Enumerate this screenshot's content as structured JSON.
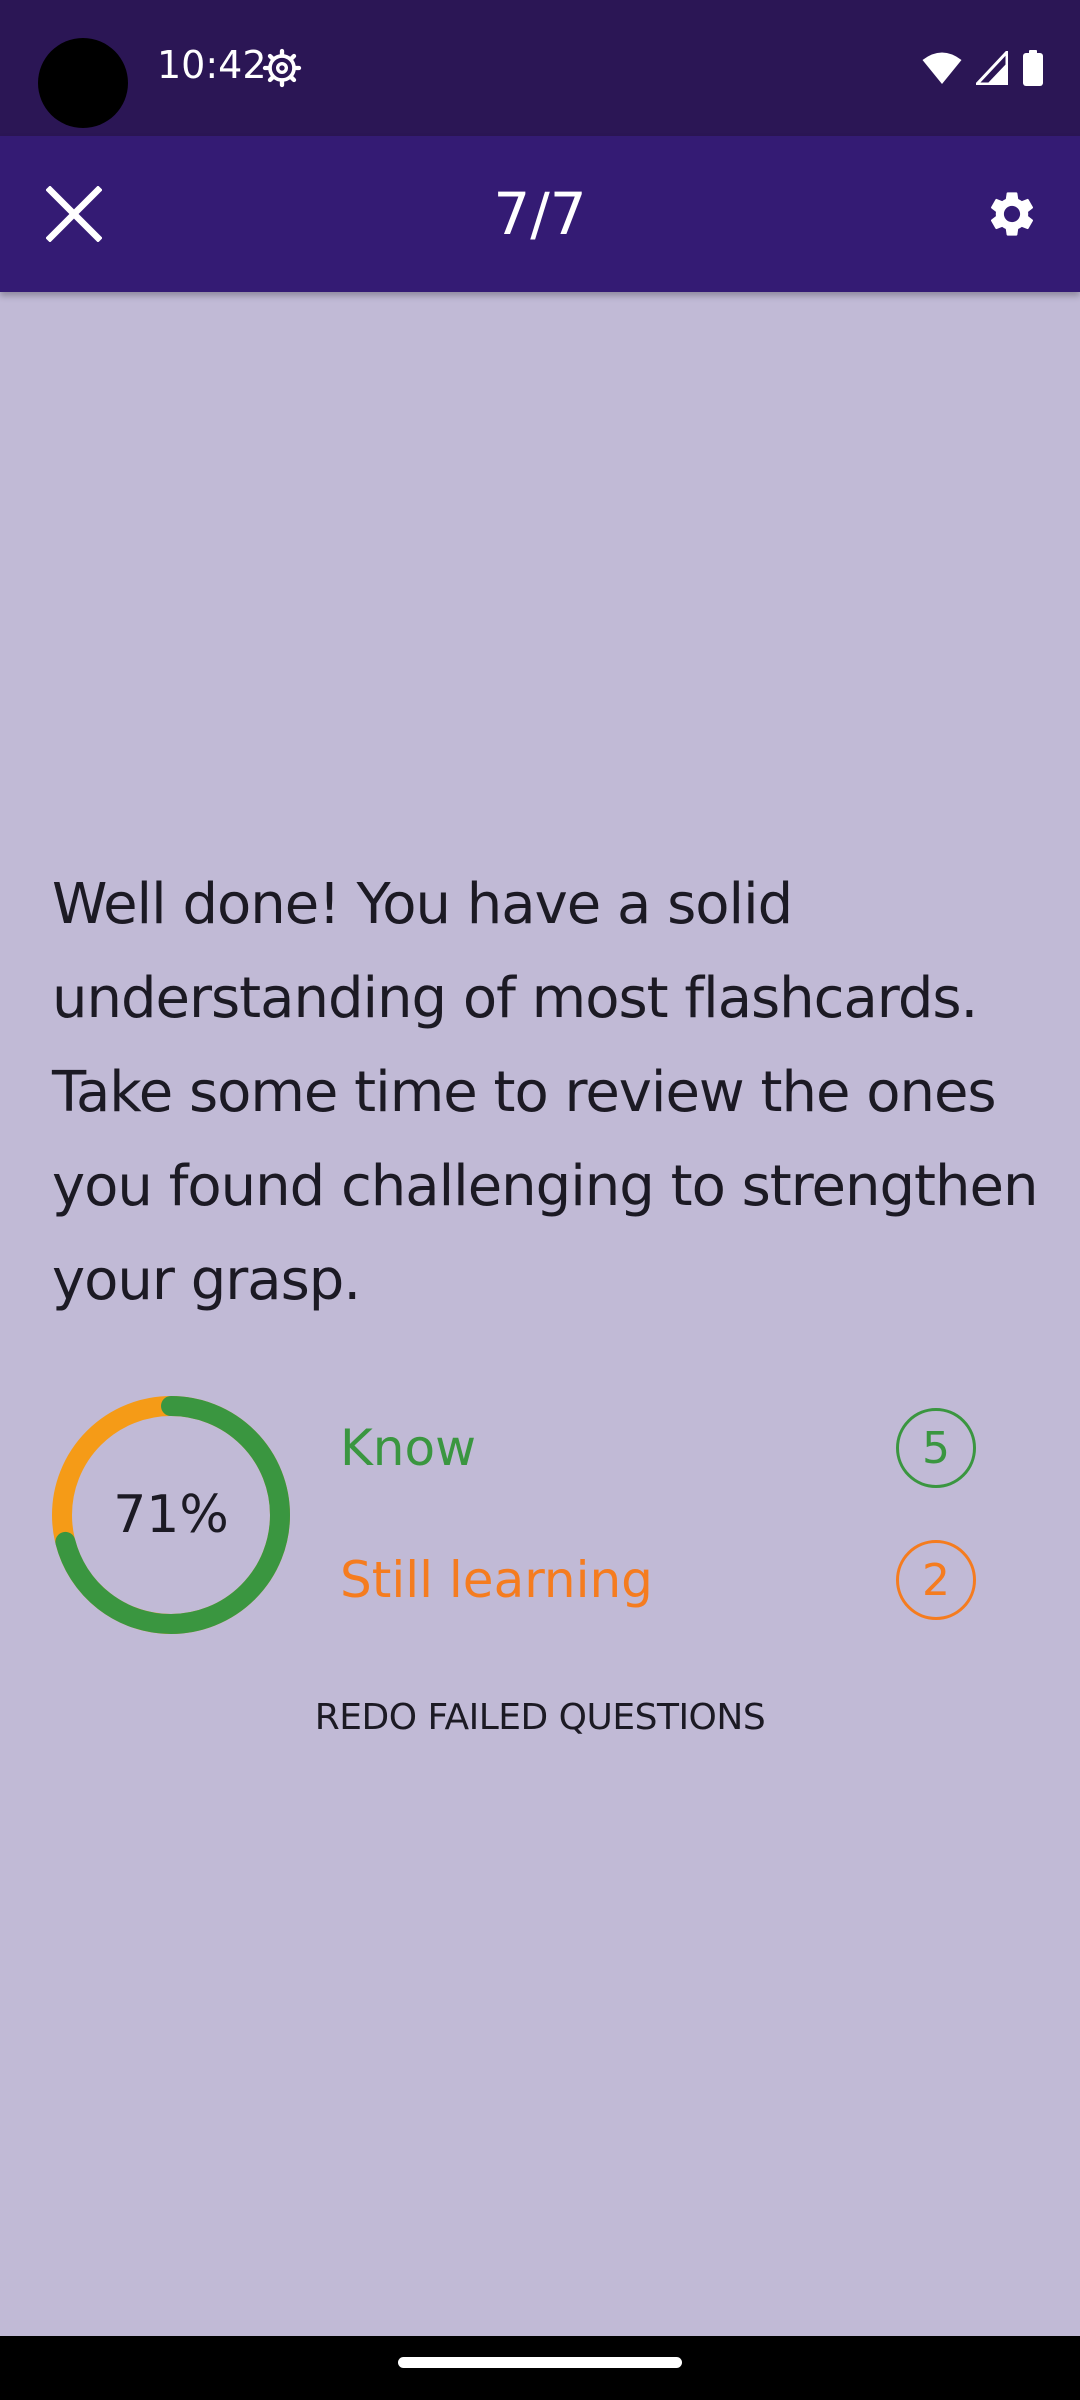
{
  "status_bar": {
    "time": "10:42",
    "icons": [
      "camera-cutout",
      "settings-gear-icon",
      "wifi-icon",
      "signal-icon",
      "battery-icon"
    ]
  },
  "app_bar": {
    "title": "7/7",
    "close_icon": "close-icon",
    "settings_icon": "settings-icon"
  },
  "result": {
    "message": "Well done! You have a solid understanding of most flashcards. Take some time to review the ones you found challenging to strengthen your grasp.",
    "percent_label": "71%",
    "percent_value": 0.71,
    "know": {
      "label": "Know",
      "count": "5",
      "color": "#3a9640"
    },
    "still_learning": {
      "label": "Still learning",
      "count": "2",
      "color": "#f57c1f"
    },
    "donut_colors": {
      "know": "#3a9640",
      "still_learning": "#f59b17"
    },
    "redo_label": "REDO FAILED QUESTIONS"
  },
  "colors": {
    "background": "#c1bad6",
    "status_bar": "#2b1655",
    "app_bar": "#341b74"
  }
}
